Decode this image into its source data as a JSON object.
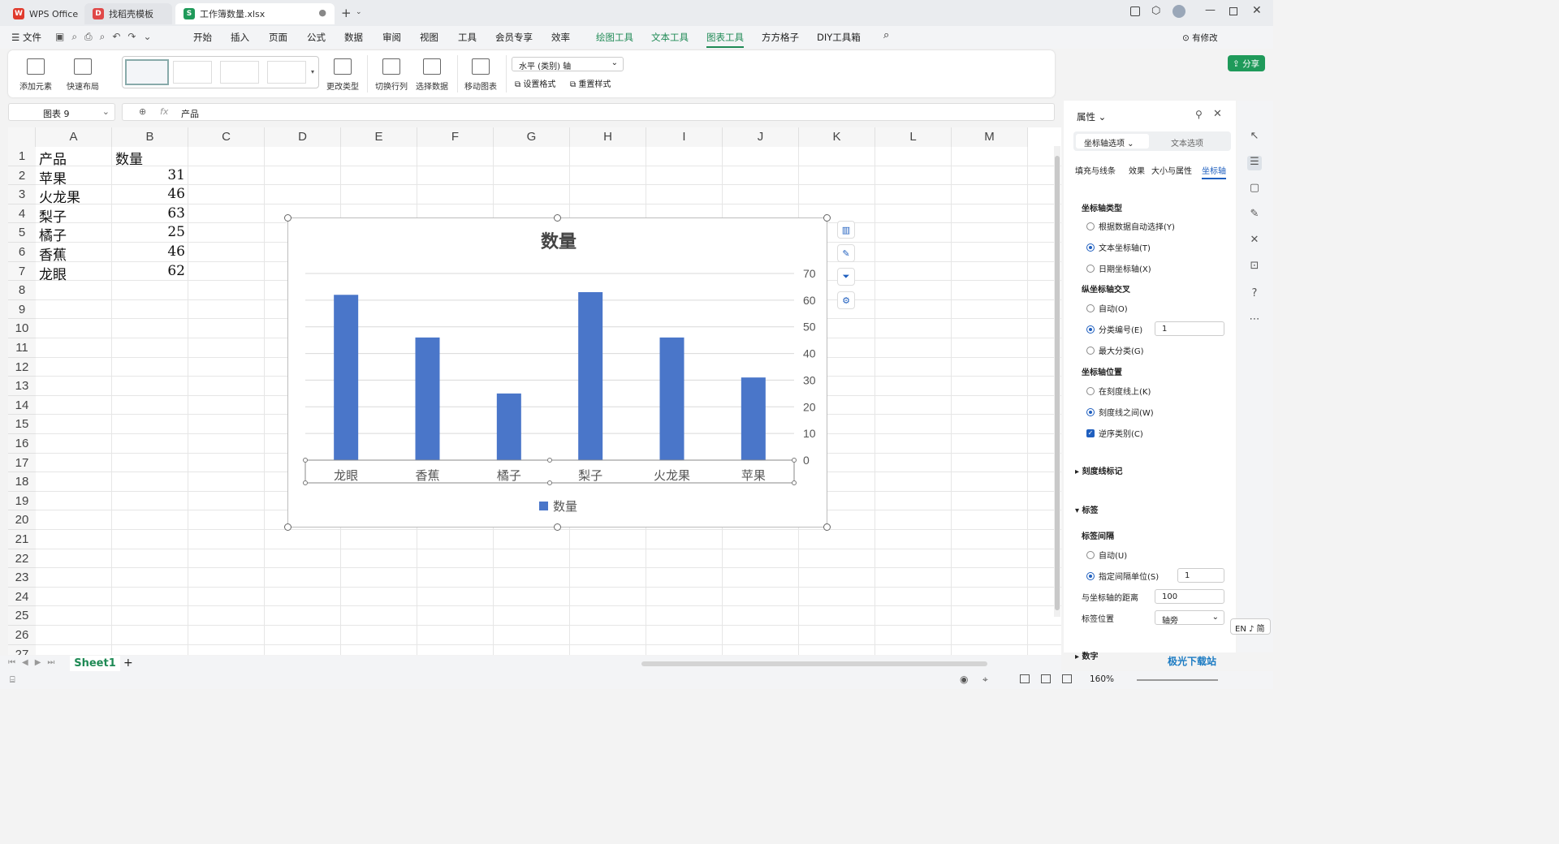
{
  "tabs": [
    {
      "label": "WPS Office"
    },
    {
      "label": "找稻壳模板"
    },
    {
      "label": "工作簿数量.xlsx"
    }
  ],
  "menu": {
    "file": "文件",
    "items": [
      "开始",
      "插入",
      "页面",
      "公式",
      "数据",
      "审阅",
      "视图",
      "工具",
      "会员专享",
      "效率",
      "绘图工具",
      "文本工具",
      "图表工具",
      "方方格子",
      "DIY工具箱"
    ],
    "modified": "有修改",
    "share": "分享"
  },
  "ribbon": {
    "add_element": "添加元素",
    "quick_layout": "快速布局",
    "change_type": "更改类型",
    "switch_row_col": "切换行列",
    "select_data": "选择数据",
    "move_chart": "移动图表",
    "axis_select": "水平 (类别) 轴",
    "set_format": "设置格式",
    "reset_style": "重置样式"
  },
  "formula": {
    "name_box": "图表 9",
    "fx": "fx",
    "value": "产品"
  },
  "columns": [
    "A",
    "B",
    "C",
    "D",
    "E",
    "F",
    "G",
    "H",
    "I",
    "J",
    "K",
    "L",
    "M"
  ],
  "rows": [
    "1",
    "2",
    "3",
    "4",
    "5",
    "6",
    "7",
    "8",
    "9",
    "10",
    "11",
    "12",
    "13",
    "14",
    "15",
    "16",
    "17",
    "18",
    "19",
    "20",
    "21",
    "22",
    "23",
    "24",
    "25",
    "26",
    "27"
  ],
  "cells": {
    "A": [
      "产品",
      "苹果",
      "火龙果",
      "梨子",
      "橘子",
      "香蕉",
      "龙眼"
    ],
    "B": [
      "数量",
      "31",
      "46",
      "63",
      "25",
      "46",
      "62"
    ]
  },
  "chart_data": {
    "type": "bar",
    "title": "数量",
    "categories": [
      "龙眼",
      "香蕉",
      "橘子",
      "梨子",
      "火龙果",
      "苹果"
    ],
    "series": [
      {
        "name": "数量",
        "values": [
          62,
          46,
          25,
          63,
          46,
          31
        ]
      }
    ],
    "yticks": [
      "70",
      "60",
      "50",
      "40",
      "30",
      "20",
      "10",
      "0"
    ],
    "ylim": [
      0,
      70
    ],
    "y_axis_side": "right",
    "grid": true,
    "legend": "bottom",
    "bar_color": "#4a76c9"
  },
  "panel": {
    "title": "属性",
    "tab_axis": "坐标轴选项",
    "tab_text": "文本选项",
    "subtabs": [
      "填充与线条",
      "效果",
      "大小与属性",
      "坐标轴"
    ],
    "axis_type": "坐标轴类型",
    "opt_auto": "根据数据自动选择(Y)",
    "opt_text": "文本坐标轴(T)",
    "opt_date": "日期坐标轴(X)",
    "vcross": "纵坐标轴交叉",
    "cross_auto": "自动(O)",
    "cross_cat": "分类编号(E)",
    "cross_cat_val": "1",
    "cross_max": "最大分类(G)",
    "axis_pos": "坐标轴位置",
    "pos_on": "在刻度线上(K)",
    "pos_between": "刻度线之间(W)",
    "reverse": "逆序类别(C)",
    "tick_marks": "刻度线标记",
    "labels": "标签",
    "label_interval": "标签间隔",
    "interval_auto": "自动(U)",
    "interval_spec": "指定间隔单位(S)",
    "interval_val": "1",
    "dist": "与坐标轴的距离",
    "dist_val": "100",
    "label_pos": "标签位置",
    "label_pos_val": "轴旁",
    "number": "数字"
  },
  "ime": "EN ♪ 简",
  "sheet_tab": "Sheet1",
  "zoom": "160%",
  "watermark": "极光下载站"
}
